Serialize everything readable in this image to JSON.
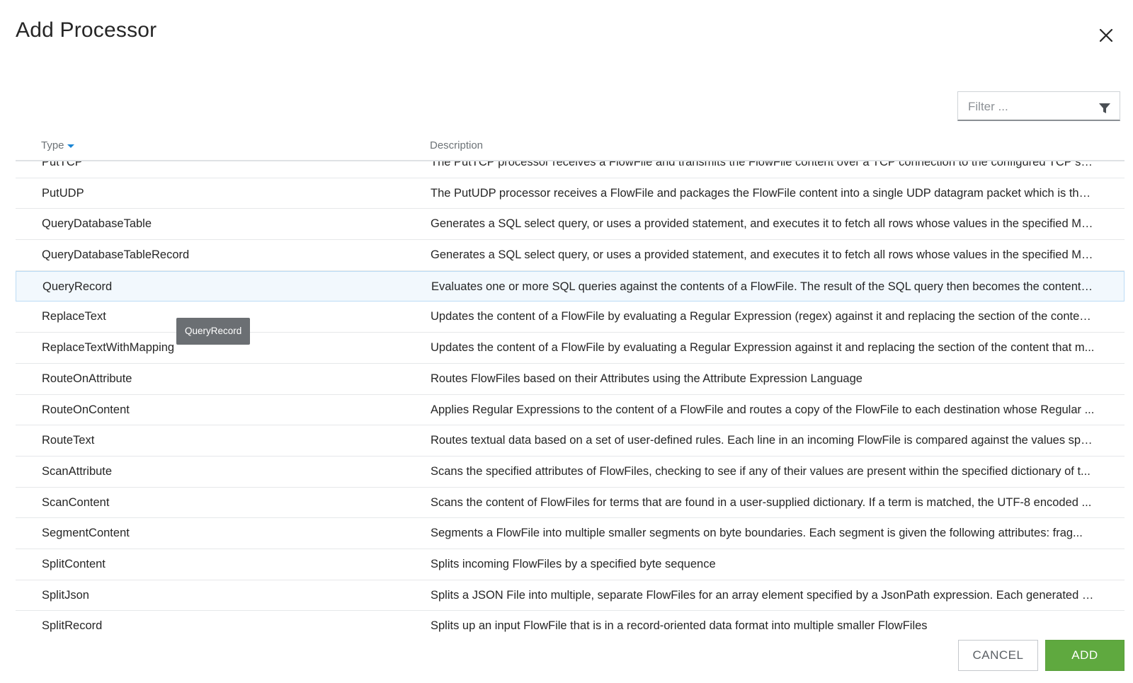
{
  "dialog": {
    "title": "Add Processor"
  },
  "filter": {
    "placeholder": "Filter ..."
  },
  "table": {
    "headers": {
      "type": "Type",
      "description": "Description"
    },
    "rows": [
      {
        "type": "PutTCP",
        "description": "The PutTCP processor receives a FlowFile and transmits the FlowFile content over a TCP connection to the configured TCP se...",
        "selected": false
      },
      {
        "type": "PutUDP",
        "description": "The PutUDP processor receives a FlowFile and packages the FlowFile content into a single UDP datagram packet which is the...",
        "selected": false
      },
      {
        "type": "QueryDatabaseTable",
        "description": "Generates a SQL select query, or uses a provided statement, and executes it to fetch all rows whose values in the specified Ma...",
        "selected": false
      },
      {
        "type": "QueryDatabaseTableRecord",
        "description": "Generates a SQL select query, or uses a provided statement, and executes it to fetch all rows whose values in the specified Ma...",
        "selected": false
      },
      {
        "type": "QueryRecord",
        "description": "Evaluates one or more SQL queries against the contents of a FlowFile. The result of the SQL query then becomes the content o...",
        "selected": true
      },
      {
        "type": "ReplaceText",
        "description": "Updates the content of a FlowFile by evaluating a Regular Expression (regex) against it and replacing the section of the conten...",
        "selected": false
      },
      {
        "type": "ReplaceTextWithMapping",
        "description": "Updates the content of a FlowFile by evaluating a Regular Expression against it and replacing the section of the content that m...",
        "selected": false
      },
      {
        "type": "RouteOnAttribute",
        "description": "Routes FlowFiles based on their Attributes using the Attribute Expression Language",
        "selected": false
      },
      {
        "type": "RouteOnContent",
        "description": "Applies Regular Expressions to the content of a FlowFile and routes a copy of the FlowFile to each destination whose Regular ...",
        "selected": false
      },
      {
        "type": "RouteText",
        "description": "Routes textual data based on a set of user-defined rules. Each line in an incoming FlowFile is compared against the values spe...",
        "selected": false
      },
      {
        "type": "ScanAttribute",
        "description": "Scans the specified attributes of FlowFiles, checking to see if any of their values are present within the specified dictionary of t...",
        "selected": false
      },
      {
        "type": "ScanContent",
        "description": "Scans the content of FlowFiles for terms that are found in a user-supplied dictionary. If a term is matched, the UTF-8 encoded ...",
        "selected": false
      },
      {
        "type": "SegmentContent",
        "description": "Segments a FlowFile into multiple smaller segments on byte boundaries. Each segment is given the following attributes: frag...",
        "selected": false
      },
      {
        "type": "SplitContent",
        "description": "Splits incoming FlowFiles by a specified byte sequence",
        "selected": false
      },
      {
        "type": "SplitJson",
        "description": "Splits a JSON File into multiple, separate FlowFiles for an array element specified by a JsonPath expression. Each generated Fl...",
        "selected": false
      },
      {
        "type": "SplitRecord",
        "description": "Splits up an input FlowFile that is in a record-oriented data format into multiple smaller FlowFiles",
        "selected": false
      }
    ]
  },
  "tooltip": {
    "text": "QueryRecord"
  },
  "buttons": {
    "cancel": "CANCEL",
    "add": "ADD"
  },
  "colors": {
    "add_button": "#5fa93f",
    "selected_row": "#f2f8fd",
    "tooltip_bg": "#6b6f73",
    "sort_caret": "#1a85d4"
  },
  "icons": {
    "close": "close-icon",
    "filter": "filter-funnel-icon",
    "sort": "sort-descending-caret-icon"
  }
}
